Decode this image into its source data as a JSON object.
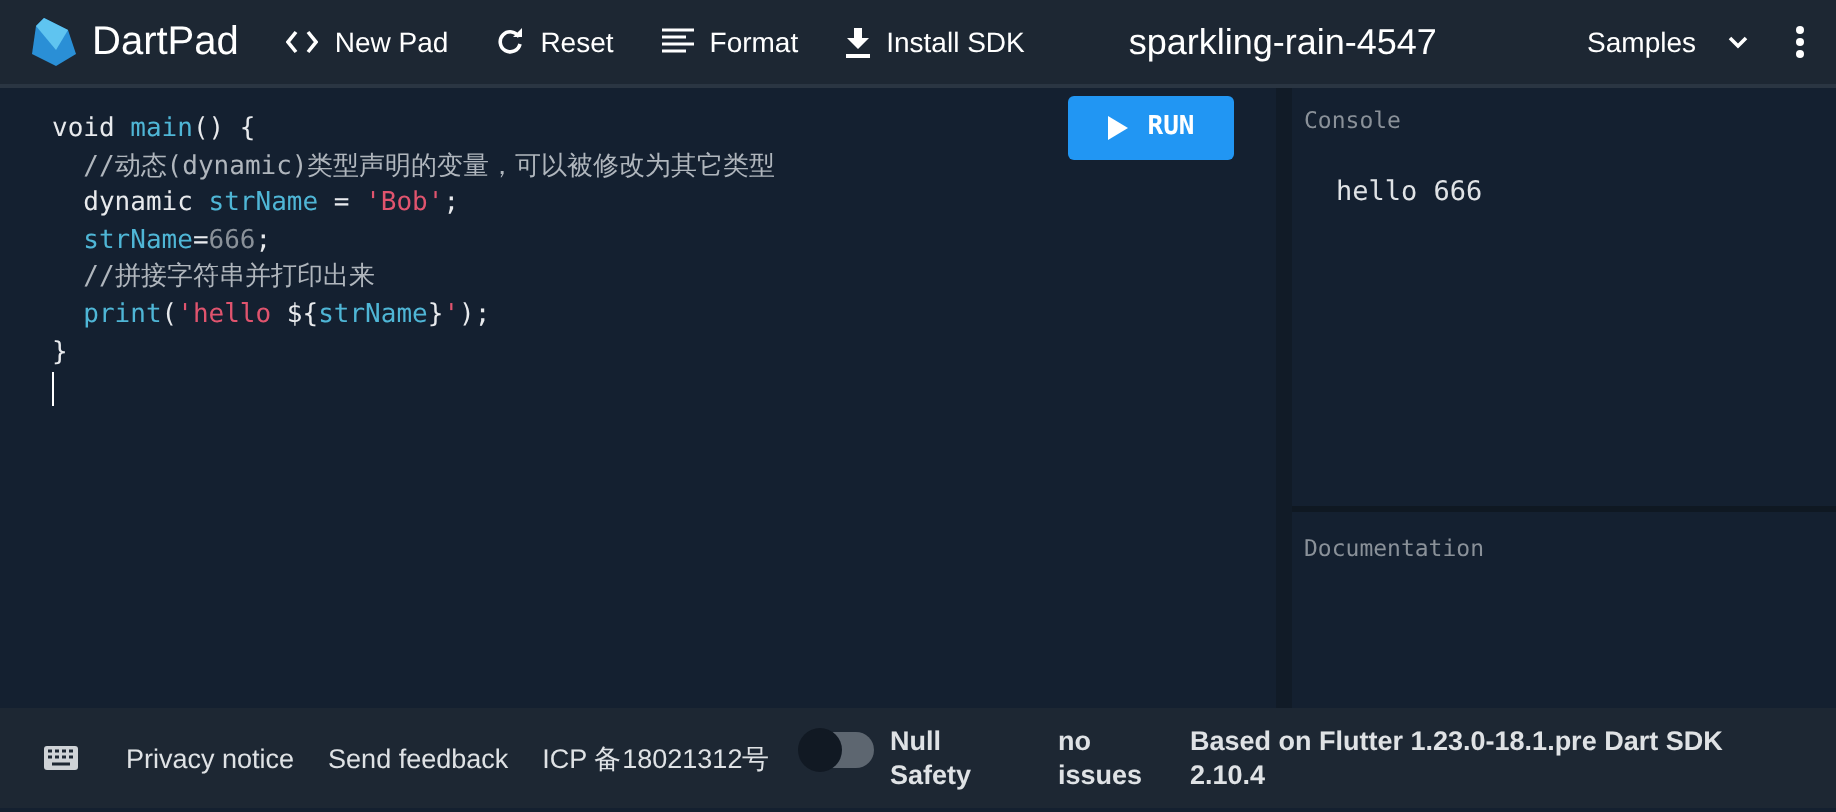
{
  "header": {
    "app_name": "DartPad",
    "actions": [
      {
        "label": "New Pad",
        "kind": "code"
      },
      {
        "label": "Reset",
        "kind": "refresh"
      },
      {
        "label": "Format",
        "kind": "format"
      },
      {
        "label": "Install SDK",
        "kind": "download"
      }
    ],
    "pad_name": "sparkling-rain-4547",
    "samples": "Samples"
  },
  "editor": {
    "lines": [
      [
        {
          "text": "void ",
          "kind": "keyword"
        },
        {
          "text": "main",
          "kind": "fn"
        },
        {
          "text": "() {",
          "kind": "plain"
        }
      ],
      [
        {
          "text": "  //动态(dynamic)类型声明的变量，可以被修改为其它类型",
          "kind": "comment"
        }
      ],
      [
        {
          "text": "  dynamic ",
          "kind": "keyword"
        },
        {
          "text": "strName",
          "kind": "fn"
        },
        {
          "text": " = ",
          "kind": "plain"
        },
        {
          "text": "'Bob'",
          "kind": "string"
        },
        {
          "text": ";",
          "kind": "plain"
        }
      ],
      [
        {
          "text": "  strName",
          "kind": "fn"
        },
        {
          "text": "=",
          "kind": "plain"
        },
        {
          "text": "666",
          "kind": "number"
        },
        {
          "text": ";",
          "kind": "plain"
        }
      ],
      [
        {
          "text": "  //拼接字符串并打印出来",
          "kind": "comment"
        }
      ],
      [
        {
          "text": "  print",
          "kind": "fn"
        },
        {
          "text": "(",
          "kind": "plain"
        },
        {
          "text": "'hello ",
          "kind": "string"
        },
        {
          "text": "${",
          "kind": "plain"
        },
        {
          "text": "strName",
          "kind": "fn"
        },
        {
          "text": "}",
          "kind": "plain"
        },
        {
          "text": "'",
          "kind": "string"
        },
        {
          "text": ");",
          "kind": "plain"
        }
      ],
      [
        {
          "text": "}",
          "kind": "plain"
        }
      ]
    ],
    "run_button": "RUN"
  },
  "console": {
    "title": "Console",
    "output": "hello 666"
  },
  "documentation": {
    "title": "Documentation"
  },
  "footer": {
    "links": [
      "Privacy notice",
      "Send feedback",
      "ICP 备18021312号"
    ],
    "null_safety": {
      "label": "Null Safety",
      "on": false
    },
    "issues": "no issues",
    "version": "Based on Flutter 1.23.0-18.1.pre Dart SDK 2.10.4"
  }
}
